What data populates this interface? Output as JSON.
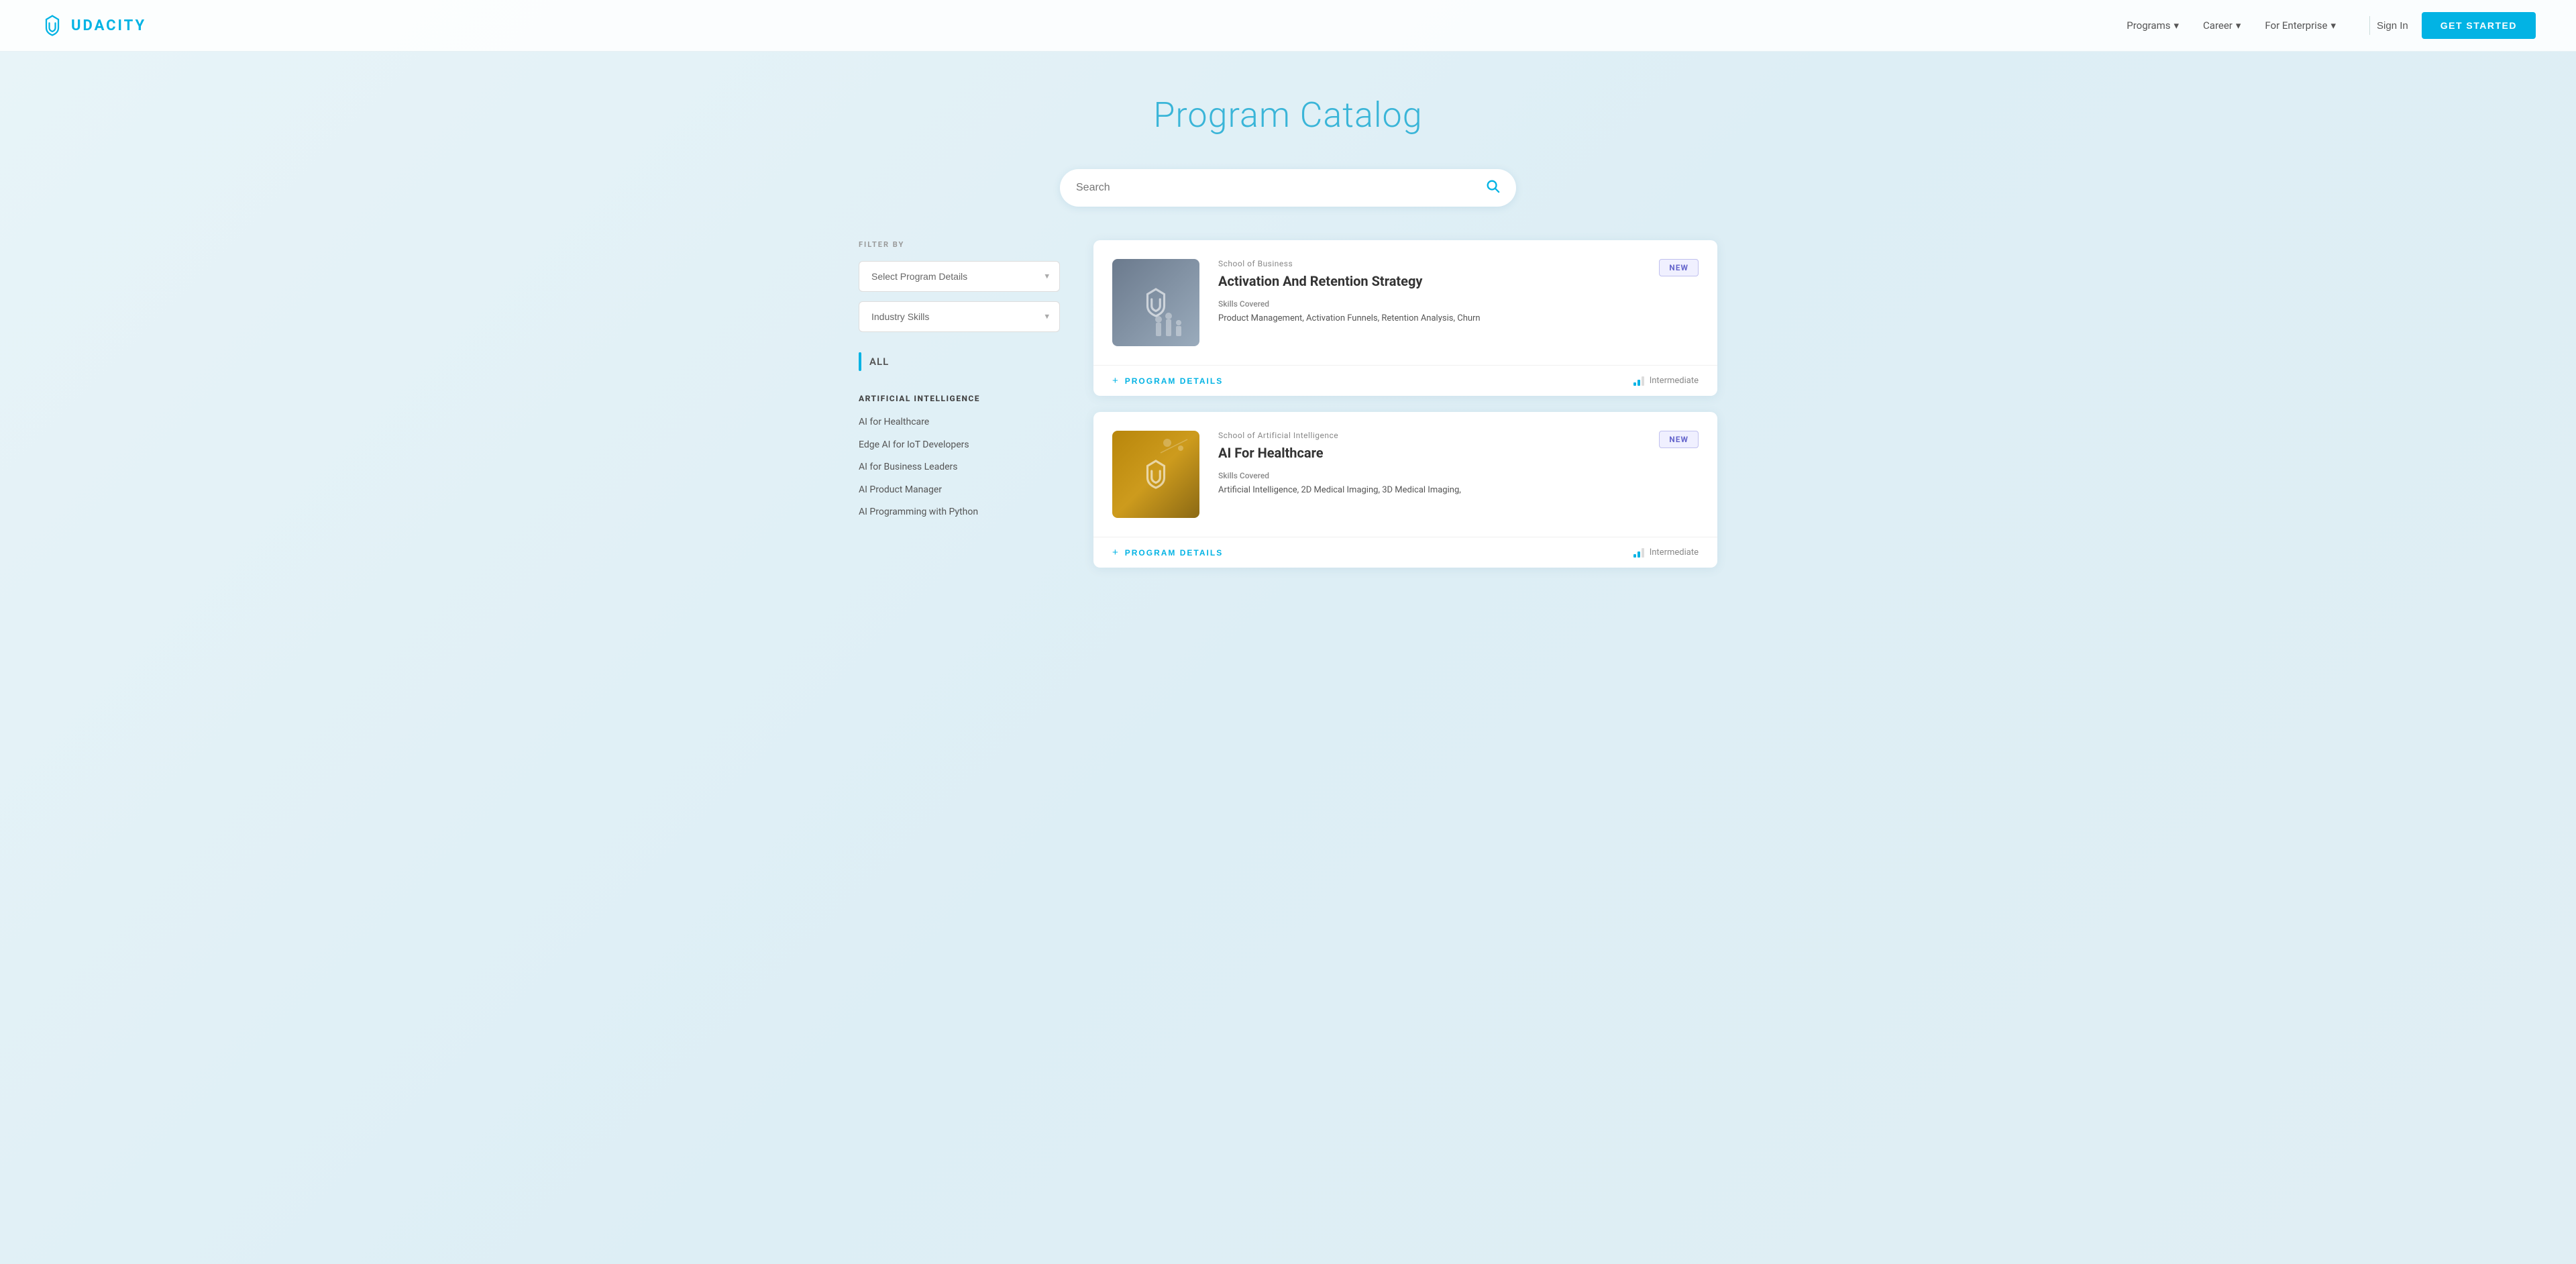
{
  "navbar": {
    "logo_text": "UDACITY",
    "nav_items": [
      {
        "label": "Programs",
        "has_dropdown": true
      },
      {
        "label": "Career",
        "has_dropdown": true
      },
      {
        "label": "For Enterprise",
        "has_dropdown": true
      }
    ],
    "sign_in_label": "Sign In",
    "get_started_label": "GET STARTED"
  },
  "hero": {
    "title": "Program Catalog"
  },
  "search": {
    "placeholder": "Search"
  },
  "sidebar": {
    "filter_label": "FILTER BY",
    "dropdown1": {
      "placeholder": "Select Program Details",
      "options": [
        "Select Program Details"
      ]
    },
    "dropdown2": {
      "placeholder": "Industry Skills",
      "options": [
        "Industry Skills"
      ]
    },
    "all_label": "ALL",
    "categories": [
      {
        "title": "ARTIFICIAL INTELLIGENCE",
        "items": [
          "AI for Healthcare",
          "Edge AI for IoT Developers",
          "AI for Business Leaders",
          "AI Product Manager",
          "AI Programming with Python"
        ]
      }
    ]
  },
  "cards": [
    {
      "id": "card-1",
      "school": "School of Business",
      "title": "Activation And Retention Strategy",
      "skills_label": "Skills Covered",
      "skills": "Product Management, Activation Funnels, Retention Analysis, Churn",
      "badge": "NEW",
      "program_details_label": "PROGRAM DETAILS",
      "level": "Intermediate",
      "thumbnail_color_start": "#6b7a8d",
      "thumbnail_color_end": "#9aabbc"
    },
    {
      "id": "card-2",
      "school": "School of Artificial Intelligence",
      "title": "AI For Healthcare",
      "skills_label": "Skills Covered",
      "skills": "Artificial Intelligence, 2D Medical Imaging, 3D Medical Imaging,",
      "badge": "NEW",
      "program_details_label": "PROGRAM DETAILS",
      "level": "Intermediate",
      "thumbnail_color_start": "#b8860b",
      "thumbnail_color_end": "#8b6914"
    }
  ]
}
